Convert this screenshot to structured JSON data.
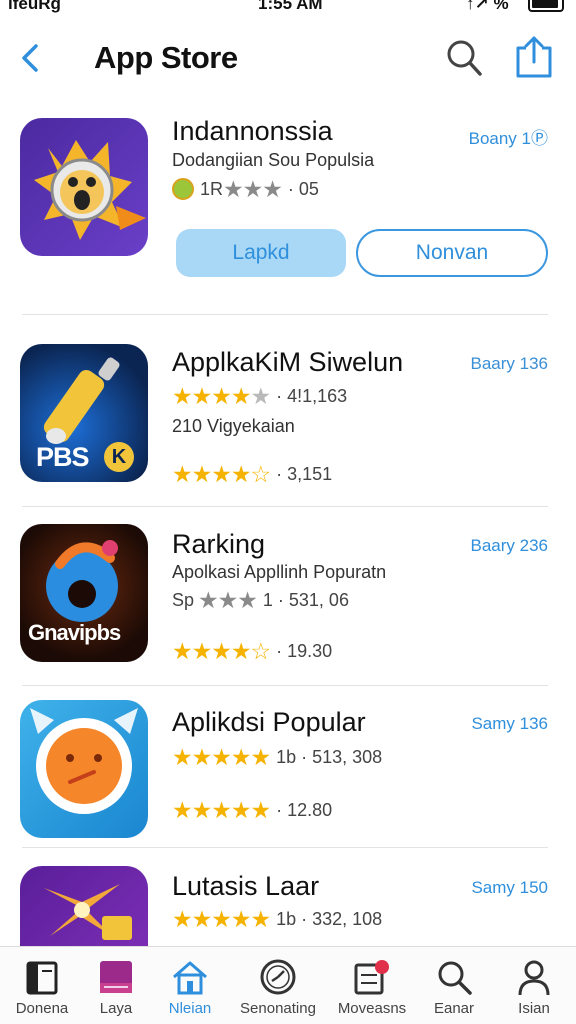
{
  "status_bar": {
    "carrier": "ifeuRg",
    "time": "1:55 AM",
    "right": "↑↗ %"
  },
  "nav": {
    "title": "App Store"
  },
  "apps": [
    {
      "name": "Indannonssia",
      "badge": "Boany 1Ⓟ",
      "subtitle": "Dodangiian Sou Populsia",
      "rating_text": "1R",
      "stars": "★★★",
      "count": "· 05"
    },
    {
      "name": "ApplkaKiM Siwelun",
      "badge": "Baary 136",
      "subtitle": "210 Vigyekaian",
      "stars_a": "★★★★",
      "stars_a_off": "★",
      "count_a": "· 4!1,163",
      "stars_b": "★★★★",
      "stars_b_off": "☆",
      "count_b": "· 3,151",
      "icon_text": "PBS",
      "icon_badge": "K"
    },
    {
      "name": "Rarking",
      "badge": "Baary 236",
      "subtitle": "Apolkasi Appllinh Popuratn",
      "sp": "Sp",
      "stars_a": "★★★",
      "count_a": "1 · 531, 06",
      "stars_b": "★★★★",
      "stars_b_off": "☆",
      "count_b": "· 19.30",
      "icon_text": "Gnavipbs"
    },
    {
      "name": "Aplikdsi Popular",
      "badge": "Samy 136",
      "stars_a": "★★★★★",
      "count_a": "1b · 513, 308",
      "stars_b": "★★★★★",
      "count_b": "· 12.80"
    },
    {
      "name": "Lutasis Laar",
      "badge": "Samy 150",
      "stars_a": "★★★★",
      "stars_a_half": "★",
      "count_a": "1b · 332, 108"
    }
  ],
  "buttons": {
    "primary": "Lapkd",
    "secondary": "Nonvan"
  },
  "tabs": [
    {
      "label": "Donena",
      "icon": "book-icon"
    },
    {
      "label": "Laya",
      "icon": "folder-icon"
    },
    {
      "label": "Nleian",
      "icon": "home-icon"
    },
    {
      "label": "Senonating",
      "icon": "clock-face-icon"
    },
    {
      "label": "Moveasns",
      "icon": "media-badge-icon"
    },
    {
      "label": "Eanar",
      "icon": "search-icon"
    },
    {
      "label": "Isian",
      "icon": "person-icon"
    }
  ],
  "colors": {
    "accent": "#2f8fdc",
    "star": "#f5b300",
    "primary_button_fill": "#a9d8f7"
  }
}
